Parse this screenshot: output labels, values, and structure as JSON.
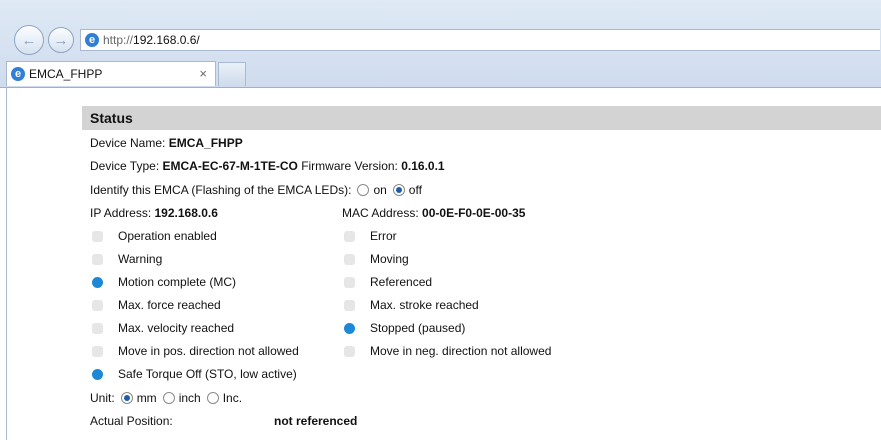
{
  "browser": {
    "back_icon": "back-arrow-icon",
    "forward_icon": "forward-arrow-icon",
    "url_prefix": "http://",
    "url_host": "192.168.0.6/",
    "tab_title": "EMCA_FHPP",
    "tab_close": "×"
  },
  "status": {
    "header": "Status",
    "device_name_label": "Device Name:",
    "device_name": "EMCA_FHPP",
    "device_type_label": "Device Type:",
    "device_type": "EMCA-EC-67-M-1TE-CO",
    "firmware_label": "Firmware Version:",
    "firmware": "0.16.0.1",
    "identify_label": "Identify this EMCA (Flashing of the EMCA LEDs):",
    "identify_on": "on",
    "identify_off": "off",
    "identify_selected": "off",
    "ip_label": "IP Address:",
    "ip": "192.168.0.6",
    "mac_label": "MAC Address:",
    "mac": "00-0E-F0-0E-00-35",
    "indicators_left": [
      {
        "label": "Operation enabled",
        "active": false
      },
      {
        "label": "Warning",
        "active": false
      },
      {
        "label": "Motion complete (MC)",
        "active": true
      },
      {
        "label": "Max. force reached",
        "active": false
      },
      {
        "label": "Max. velocity reached",
        "active": false
      },
      {
        "label": "Move in pos. direction not allowed",
        "active": false
      },
      {
        "label": "Safe Torque Off (STO, low active)",
        "active": true
      }
    ],
    "indicators_right": [
      {
        "label": "Error",
        "active": false
      },
      {
        "label": "Moving",
        "active": false
      },
      {
        "label": "Referenced",
        "active": false
      },
      {
        "label": "Max. stroke reached",
        "active": false
      },
      {
        "label": "Stopped (paused)",
        "active": true
      },
      {
        "label": "Move in neg. direction not allowed",
        "active": false
      }
    ],
    "unit_label": "Unit:",
    "units": [
      "mm",
      "inch",
      "Inc."
    ],
    "unit_selected": "mm",
    "position_label": "Actual Position:",
    "position_value": "not referenced"
  },
  "colors": {
    "active_led": "#1e88d8",
    "inactive_led": "#e6e6e6",
    "header_bg": "#d3d3d3"
  }
}
